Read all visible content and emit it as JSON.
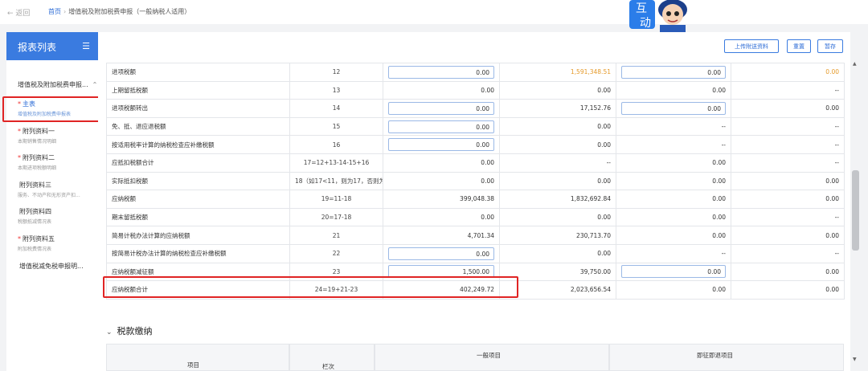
{
  "nav": {
    "back_label": "← 返回",
    "home": "首页",
    "sep": "›",
    "page": "增值税及附加税费申报（一般纳税人适用）"
  },
  "mascot": {
    "text1": "互",
    "text2": "动"
  },
  "sidebar": {
    "title": "报表列表",
    "menu_icon": "list-collapse-icon",
    "group": "增值税及附加税费申报...",
    "items": [
      {
        "required": "*",
        "title": "主表",
        "sub": "增值税及附加税费申报表"
      },
      {
        "required": "*",
        "title": "附列资料一",
        "sub": "本期销售情况明细"
      },
      {
        "required": "*",
        "title": "附列资料二",
        "sub": "本期进项税额明细"
      },
      {
        "required": "",
        "title": "附列资料三",
        "sub": "服务、不动产和无形资产扣..."
      },
      {
        "required": "",
        "title": "附列资料四",
        "sub": "税额抵减情况表"
      },
      {
        "required": "*",
        "title": "附列资料五",
        "sub": "附加税费情况表"
      },
      {
        "required": "",
        "title": "增值税减免税申报明...",
        "sub": ""
      }
    ]
  },
  "toolbar": {
    "upload": "上传附送资料",
    "reset": "重置",
    "save": "暂存"
  },
  "table": {
    "rows": [
      {
        "name": "进项税额",
        "no": "12",
        "v1": "0.00",
        "v2": "1,591,348.51",
        "v3": "0.00",
        "v4": "0.00"
      },
      {
        "name": "上期留抵税额",
        "no": "13",
        "v1": "0.00",
        "v2": "0.00",
        "v3": "0.00",
        "v4": "--"
      },
      {
        "name": "进项税额转出",
        "no": "14",
        "v1": "0.00",
        "v2": "17,152.76",
        "v3": "0.00",
        "v4": "0.00"
      },
      {
        "name": "免、抵、退应退税额",
        "no": "15",
        "v1": "0.00",
        "v2": "0.00",
        "v3": "--",
        "v4": "--"
      },
      {
        "name": "按适用税率计算的纳税检查应补缴税额",
        "no": "16",
        "v1": "0.00",
        "v2": "0.00",
        "v3": "--",
        "v4": "--"
      },
      {
        "name": "应抵扣税额合计",
        "no": "17=12+13-14-15+16",
        "v1": "0.00",
        "v2": "--",
        "v3": "0.00",
        "v4": "--"
      },
      {
        "name": "实际抵扣税额",
        "no": "18（如17<11，则为17，否则为11）",
        "v1": "0.00",
        "v2": "0.00",
        "v3": "0.00",
        "v4": "0.00"
      },
      {
        "name": "应纳税额",
        "no": "19=11-18",
        "v1": "399,048.38",
        "v2": "1,832,692.84",
        "v3": "0.00",
        "v4": "0.00"
      },
      {
        "name": "期末留抵税额",
        "no": "20=17-18",
        "v1": "0.00",
        "v2": "0.00",
        "v3": "0.00",
        "v4": "--"
      },
      {
        "name": "简易计税办法计算的应纳税额",
        "no": "21",
        "v1": "4,701.34",
        "v2": "230,713.70",
        "v3": "0.00",
        "v4": "0.00"
      },
      {
        "name": "按简易计税办法计算的纳税检查应补缴税额",
        "no": "22",
        "v1": "0.00",
        "v2": "0.00",
        "v3": "--",
        "v4": "--"
      },
      {
        "name": "应纳税额减征额",
        "no": "23",
        "v1": "1,500.00",
        "v2": "39,750.00",
        "v3": "0.00",
        "v4": "0.00"
      },
      {
        "name": "应纳税额合计",
        "no": "24=19+21-23",
        "v1": "402,249.72",
        "v2": "2,023,656.54",
        "v3": "0.00",
        "v4": "0.00"
      }
    ]
  },
  "section": {
    "title": "税款缴纳",
    "col_item": "项目",
    "col_no": "栏次",
    "col_general": "一般项目",
    "col_instant": "即征即退项目"
  },
  "colors": {
    "accent": "#3a7be0",
    "highlight": "#e02424",
    "orange": "#e59a2a"
  }
}
